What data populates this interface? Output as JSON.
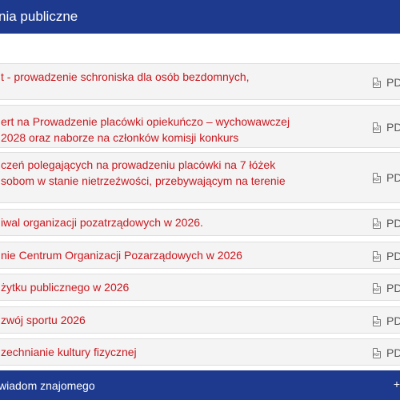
{
  "header": {
    "title": "nia publiczne"
  },
  "rows": [
    {
      "lines": [
        "t - prowadzenie schroniska dla osób bezdomnych,",
        ""
      ],
      "file_type": "PD",
      "icon": "pdf-icon"
    },
    {
      "lines": [
        "ert na Prowadzenie placówki opiekuńczo – wychowawczej",
        "2028 oraz naborze na członków komisji konkurs"
      ],
      "file_type": "PD",
      "icon": "pdf-icon"
    },
    {
      "lines": [
        "czeń polegających na prowadzeniu placówki na 7 łóżek",
        "sobom w stanie nietrzeźwości, przebywającym na terenie"
      ],
      "file_type": "PD",
      "icon": "pdf-icon"
    },
    {
      "lines": [
        "iwal organizacji pozatrządowych w 2026."
      ],
      "file_type": "PD",
      "icon": "pdf-icon"
    },
    {
      "lines": [
        "nie Centrum Organizacji Pozarządowych w 2026"
      ],
      "file_type": "PD",
      "icon": "pdf-icon"
    },
    {
      "lines": [
        "żytku publicznego w 2026"
      ],
      "file_type": "PD",
      "icon": "pdf-icon"
    },
    {
      "lines": [
        "zwój sportu 2026"
      ],
      "file_type": "PD",
      "icon": "pdf-icon"
    },
    {
      "lines": [
        "zechnianie kultury fizycznej"
      ],
      "file_type": "PD",
      "icon": "pdf-icon"
    }
  ],
  "footer": {
    "title": "wiadom znajomego",
    "toggle": "+"
  }
}
